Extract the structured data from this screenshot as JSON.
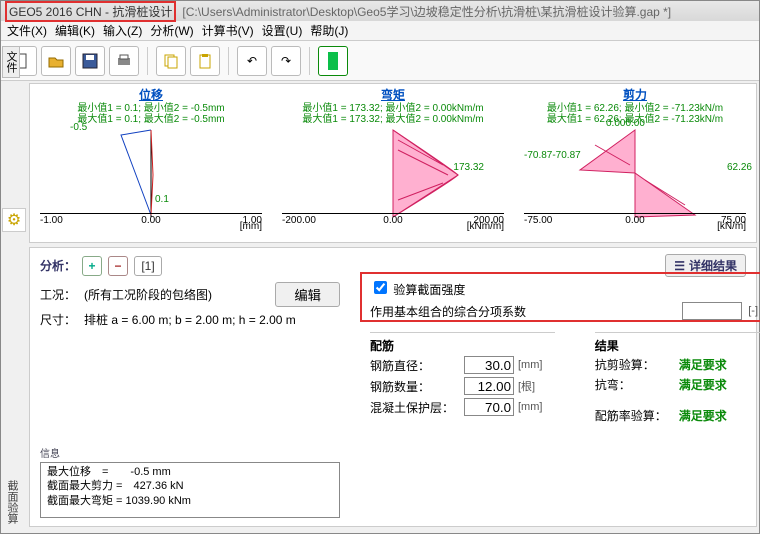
{
  "title": {
    "app": "GEO5 2016 CHN - 抗滑桩设计",
    "path": "[C:\\Users\\Administrator\\Desktop\\Geo5学习\\边坡稳定性分析\\抗滑桩\\某抗滑桩设计验算.gap *]"
  },
  "menu": {
    "file": "文件(X)",
    "edit": "编辑(K)",
    "input": "输入(Z)",
    "analyze": "分析(W)",
    "calc": "计算书(V)",
    "settings": "设置(U)",
    "help": "帮助(J)"
  },
  "sidetab": "文件",
  "sidetab2": "截面验算",
  "charts": {
    "disp": {
      "title": "位移",
      "line1": "最小值1 = 0.1; 最小值2 = -0.5mm",
      "line2": "最大值1 = 0.1; 最大值2 = -0.5mm",
      "unit": "[mm]",
      "amin": "-1.00",
      "amid": "0.00",
      "amax": "1.00",
      "v1": "-0.5",
      "v2": "0.1"
    },
    "moment": {
      "title": "弯矩",
      "line1": "最小值1 = 173.32; 最小值2 = 0.00kNm/m",
      "line2": "最大值1 = 173.32; 最大值2 = 0.00kNm/m",
      "unit": "[kNm/m]",
      "amin": "-200.00",
      "amid": "0.00",
      "amax": "200.00",
      "v1": "173.32"
    },
    "shear": {
      "title": "剪力",
      "line1": "最小值1 = 62.26; 最小值2 = -71.23kN/m",
      "line2": "最大值1 = 62.26; 最大值2 = -71.23kN/m",
      "unit": "[kN/m]",
      "amin": "-75.00",
      "amid": "0.00",
      "amax": "75.00",
      "vtop": "0.000.00",
      "v1": "-70.87-70.87",
      "v2": "62.26"
    }
  },
  "panel": {
    "title": "分析：",
    "add": "+",
    "del": "−",
    "num": "[1]",
    "details": "详细结果"
  },
  "left": {
    "cond_label": "工况：",
    "cond_val": "(所有工况阶段的包络图)",
    "edit": "编辑",
    "size_label": "尺寸：",
    "size_val": "排桩 a = 6.00 m; b = 2.00 m; h = 2.00 m"
  },
  "redbox": {
    "chk": "验算截面强度",
    "coef_label": "作用基本组合的综合分项系数",
    "coef_val": "",
    "coef_unit": "[-]"
  },
  "rebar": {
    "title": "配筋",
    "dia_label": "钢筋直径：",
    "dia_val": "30.0",
    "dia_unit": "[mm]",
    "num_label": "钢筋数量：",
    "num_val": "12.00",
    "num_unit": "[根]",
    "cov_label": "混凝土保护层：",
    "cov_val": "70.0",
    "cov_unit": "[mm]"
  },
  "result": {
    "title": "结果",
    "r1l": "抗剪验算：",
    "r2l": "抗弯：",
    "r3l": "配筋率验算：",
    "ok": "满足要求"
  },
  "info": {
    "title": "信息",
    "l1": "最大位移 =  -0.5 mm",
    "l2": "截面最大剪力 = 427.36 kN",
    "l3": "截面最大弯矩 = 1039.90 kNm"
  }
}
